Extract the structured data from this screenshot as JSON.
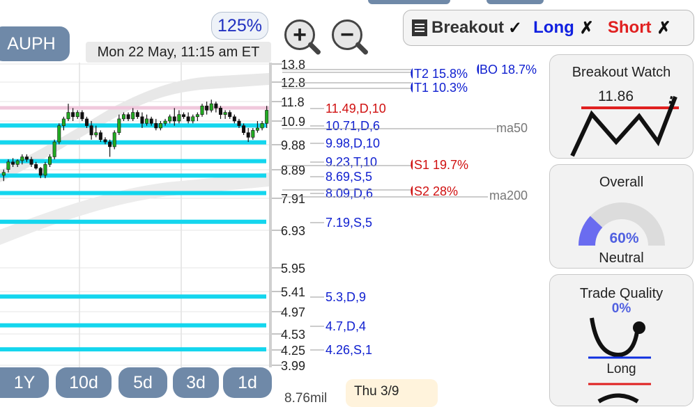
{
  "ticker": "AUPH",
  "zoom_level": "125%",
  "datetime": "Mon 22 May, 11:15 am ET",
  "zoom_in_icon": "magnifier-plus",
  "zoom_out_icon": "magnifier-minus",
  "status": {
    "breakout_label": "Breakout",
    "breakout_mark": "✓",
    "long_label": "Long",
    "long_mark": "✗",
    "short_label": "Short",
    "short_mark": "✗",
    "colors": {
      "breakout": "#333333",
      "long": "#1020e0",
      "short": "#e02020"
    }
  },
  "cards": {
    "breakout_watch": {
      "title": "Breakout Watch",
      "value": "11.86"
    },
    "overall": {
      "title": "Overall",
      "percent": "60%",
      "percent_value": 60,
      "label": "Neutral"
    },
    "trade_quality": {
      "title": "Trade Quality",
      "percent": "0%",
      "percent_value": 0,
      "label": "Long"
    }
  },
  "range_buttons": [
    "1Y",
    "10d",
    "5d",
    "3d",
    "1d"
  ],
  "volume_label": "8.76mil",
  "date_tooltip": "Thu 3/9",
  "chart_data": {
    "type": "candlestick",
    "ylim": [
      3.99,
      13.8
    ],
    "price_ticks": [
      "13.8",
      "12.8",
      "11.8",
      "10.9",
      "9.88",
      "8.89",
      "7.91",
      "6.93",
      "5.95",
      "5.41",
      "4.97",
      "4.53",
      "4.25",
      "3.99"
    ],
    "levels": [
      {
        "label": "11.49,D,10",
        "price": 11.49,
        "color": "#d01010"
      },
      {
        "label": "10.71,D,6",
        "price": 10.71,
        "color": "#1020d0"
      },
      {
        "label": "9.98,D,10",
        "price": 9.98,
        "color": "#1020d0"
      },
      {
        "label": "9.23,T,10",
        "price": 9.23,
        "color": "#1020d0"
      },
      {
        "label": "8.69,S,5",
        "price": 8.69,
        "color": "#1020d0"
      },
      {
        "label": "8.09,D,6",
        "price": 8.09,
        "color": "#1020d0"
      },
      {
        "label": "7.19,S,5",
        "price": 7.19,
        "color": "#1020d0"
      },
      {
        "label": "5.3,D,9",
        "price": 5.3,
        "color": "#1020d0"
      },
      {
        "label": "4.7,D,4",
        "price": 4.7,
        "color": "#1020d0"
      },
      {
        "label": "4.26,S,1",
        "price": 4.26,
        "color": "#1020d0"
      }
    ],
    "targets": [
      {
        "label": "T2 15.8%",
        "color": "#1020d0"
      },
      {
        "label": "T1 10.3%",
        "color": "#1020d0"
      },
      {
        "label": "BO 18.7%",
        "color": "#1020d0"
      },
      {
        "label": "S1 19.7%",
        "color": "#d01010"
      },
      {
        "label": "S2 28%",
        "color": "#d01010"
      }
    ],
    "moving_averages": [
      "ma50",
      "ma200"
    ],
    "candles": [
      {
        "o": 8.7,
        "h": 8.9,
        "l": 8.5,
        "c": 8.8
      },
      {
        "o": 8.9,
        "h": 9.3,
        "l": 8.8,
        "c": 9.2
      },
      {
        "o": 9.2,
        "h": 9.35,
        "l": 9.0,
        "c": 9.1
      },
      {
        "o": 9.1,
        "h": 9.3,
        "l": 9.0,
        "c": 9.25
      },
      {
        "o": 9.25,
        "h": 9.5,
        "l": 9.1,
        "c": 9.4
      },
      {
        "o": 9.4,
        "h": 9.5,
        "l": 9.2,
        "c": 9.3
      },
      {
        "o": 9.3,
        "h": 9.4,
        "l": 9.0,
        "c": 9.1
      },
      {
        "o": 9.1,
        "h": 9.2,
        "l": 8.9,
        "c": 8.95
      },
      {
        "o": 8.95,
        "h": 9.0,
        "l": 8.6,
        "c": 8.7
      },
      {
        "o": 8.7,
        "h": 9.2,
        "l": 8.6,
        "c": 9.1
      },
      {
        "o": 9.1,
        "h": 9.5,
        "l": 9.0,
        "c": 9.4
      },
      {
        "o": 9.4,
        "h": 10.1,
        "l": 9.3,
        "c": 10.0
      },
      {
        "o": 10.0,
        "h": 10.8,
        "l": 9.9,
        "c": 10.7
      },
      {
        "o": 10.7,
        "h": 11.1,
        "l": 10.5,
        "c": 11.0
      },
      {
        "o": 11.0,
        "h": 11.7,
        "l": 10.9,
        "c": 11.3
      },
      {
        "o": 11.3,
        "h": 11.5,
        "l": 10.9,
        "c": 11.1
      },
      {
        "o": 11.1,
        "h": 11.4,
        "l": 11.0,
        "c": 11.3
      },
      {
        "o": 11.3,
        "h": 11.4,
        "l": 10.9,
        "c": 11.0
      },
      {
        "o": 11.0,
        "h": 11.1,
        "l": 10.6,
        "c": 10.7
      },
      {
        "o": 10.7,
        "h": 10.9,
        "l": 10.1,
        "c": 10.3
      },
      {
        "o": 10.3,
        "h": 10.7,
        "l": 10.2,
        "c": 10.4
      },
      {
        "o": 10.4,
        "h": 10.5,
        "l": 10.0,
        "c": 10.1
      },
      {
        "o": 10.1,
        "h": 10.2,
        "l": 9.9,
        "c": 10.0
      },
      {
        "o": 10.0,
        "h": 10.1,
        "l": 9.4,
        "c": 9.8
      },
      {
        "o": 9.8,
        "h": 10.5,
        "l": 9.7,
        "c": 10.4
      },
      {
        "o": 10.4,
        "h": 11.2,
        "l": 10.3,
        "c": 11.0
      },
      {
        "o": 11.0,
        "h": 11.3,
        "l": 10.9,
        "c": 11.2
      },
      {
        "o": 11.2,
        "h": 11.3,
        "l": 10.9,
        "c": 11.0
      },
      {
        "o": 11.0,
        "h": 11.5,
        "l": 10.9,
        "c": 11.3
      },
      {
        "o": 11.3,
        "h": 11.4,
        "l": 11.0,
        "c": 11.1
      },
      {
        "o": 11.1,
        "h": 11.3,
        "l": 10.6,
        "c": 10.8
      },
      {
        "o": 10.8,
        "h": 11.2,
        "l": 10.7,
        "c": 11.0
      },
      {
        "o": 11.0,
        "h": 11.1,
        "l": 10.7,
        "c": 10.8
      },
      {
        "o": 10.8,
        "h": 11.0,
        "l": 10.5,
        "c": 10.6
      },
      {
        "o": 10.6,
        "h": 10.9,
        "l": 10.5,
        "c": 10.8
      },
      {
        "o": 10.8,
        "h": 11.0,
        "l": 10.7,
        "c": 10.9
      },
      {
        "o": 10.9,
        "h": 11.2,
        "l": 10.8,
        "c": 11.1
      },
      {
        "o": 11.1,
        "h": 11.5,
        "l": 10.7,
        "c": 10.9
      },
      {
        "o": 10.9,
        "h": 11.4,
        "l": 10.8,
        "c": 11.2
      },
      {
        "o": 11.2,
        "h": 11.3,
        "l": 11.0,
        "c": 11.1
      },
      {
        "o": 11.1,
        "h": 11.3,
        "l": 10.8,
        "c": 10.9
      },
      {
        "o": 10.9,
        "h": 11.2,
        "l": 10.8,
        "c": 11.1
      },
      {
        "o": 11.1,
        "h": 11.3,
        "l": 10.9,
        "c": 11.2
      },
      {
        "o": 11.2,
        "h": 11.7,
        "l": 11.1,
        "c": 11.6
      },
      {
        "o": 11.6,
        "h": 11.8,
        "l": 11.2,
        "c": 11.4
      },
      {
        "o": 11.4,
        "h": 11.9,
        "l": 11.3,
        "c": 11.7
      },
      {
        "o": 11.7,
        "h": 11.8,
        "l": 11.3,
        "c": 11.5
      },
      {
        "o": 11.5,
        "h": 11.6,
        "l": 11.0,
        "c": 11.2
      },
      {
        "o": 11.2,
        "h": 11.4,
        "l": 11.0,
        "c": 11.3
      },
      {
        "o": 11.3,
        "h": 11.4,
        "l": 11.0,
        "c": 11.1
      },
      {
        "o": 11.1,
        "h": 11.2,
        "l": 10.8,
        "c": 10.9
      },
      {
        "o": 10.9,
        "h": 11.0,
        "l": 10.6,
        "c": 10.7
      },
      {
        "o": 10.7,
        "h": 10.8,
        "l": 10.3,
        "c": 10.4
      },
      {
        "o": 10.4,
        "h": 10.6,
        "l": 10.0,
        "c": 10.2
      },
      {
        "o": 10.2,
        "h": 10.6,
        "l": 10.1,
        "c": 10.5
      },
      {
        "o": 10.5,
        "h": 10.9,
        "l": 10.4,
        "c": 10.6
      },
      {
        "o": 10.6,
        "h": 10.9,
        "l": 10.5,
        "c": 10.8
      },
      {
        "o": 10.8,
        "h": 11.6,
        "l": 10.6,
        "c": 11.4
      }
    ]
  }
}
